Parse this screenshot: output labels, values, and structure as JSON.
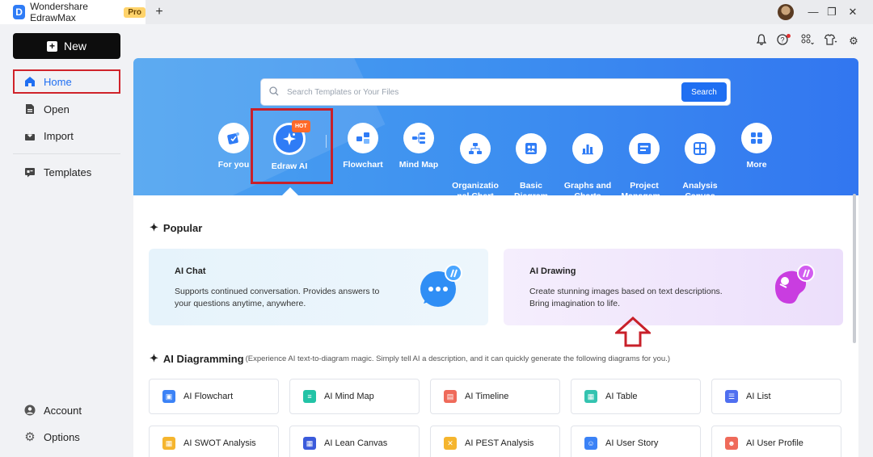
{
  "titlebar": {
    "app_name": "Wondershare EdrawMax",
    "pro_badge": "Pro",
    "new_tab": "+",
    "minimize": "—",
    "restore": "❐",
    "close": "✕"
  },
  "sidebar": {
    "new_label": "New",
    "items": [
      {
        "label": "Home",
        "icon": "home-icon"
      },
      {
        "label": "Open",
        "icon": "file-icon"
      },
      {
        "label": "Import",
        "icon": "import-icon"
      },
      {
        "label": "Templates",
        "icon": "templates-icon"
      },
      {
        "label": "Account",
        "icon": "account-icon"
      },
      {
        "label": "Options",
        "icon": "gear-icon"
      }
    ]
  },
  "search": {
    "placeholder": "Search Templates or Your Files",
    "button": "Search"
  },
  "categories": [
    {
      "label": "For you"
    },
    {
      "label": "Edraw AI",
      "badge": "HOT"
    },
    {
      "label": "Flowchart"
    },
    {
      "label": "Mind Map"
    },
    {
      "label": "Organizatio\nnal Chart"
    },
    {
      "label": "Basic\nDiagram"
    },
    {
      "label": "Graphs and\nCharts"
    },
    {
      "label": "Project\nManagem..."
    },
    {
      "label": "Analysis\nCanvas"
    },
    {
      "label": "More"
    }
  ],
  "popular": {
    "title": "Popular",
    "cards": [
      {
        "title": "AI Chat",
        "desc": "Supports continued conversation. Provides answers to your questions anytime, anywhere."
      },
      {
        "title": "AI Drawing",
        "desc": "Create stunning images based on text descriptions. Bring imagination to life."
      }
    ]
  },
  "diagramming": {
    "title": "AI Diagramming",
    "subtitle": "(Experience AI text-to-diagram magic.  Simply tell AI a description, and it can quickly generate the following diagrams for you.)",
    "items": [
      {
        "label": "AI Flowchart",
        "color": "#3b82f6"
      },
      {
        "label": "AI Mind Map",
        "color": "#22c3a6"
      },
      {
        "label": "AI Timeline",
        "color": "#ef6a5a"
      },
      {
        "label": "AI Table",
        "color": "#33c3b0"
      },
      {
        "label": "AI List",
        "color": "#4f6ff0"
      },
      {
        "label": "AI SWOT Analysis",
        "color": "#f5b52e"
      },
      {
        "label": "AI Lean Canvas",
        "color": "#3b5bdb"
      },
      {
        "label": "AI PEST Analysis",
        "color": "#f5b52e"
      },
      {
        "label": "AI User Story",
        "color": "#3b82f6"
      },
      {
        "label": "AI User Profile",
        "color": "#ef6a5a"
      }
    ]
  }
}
